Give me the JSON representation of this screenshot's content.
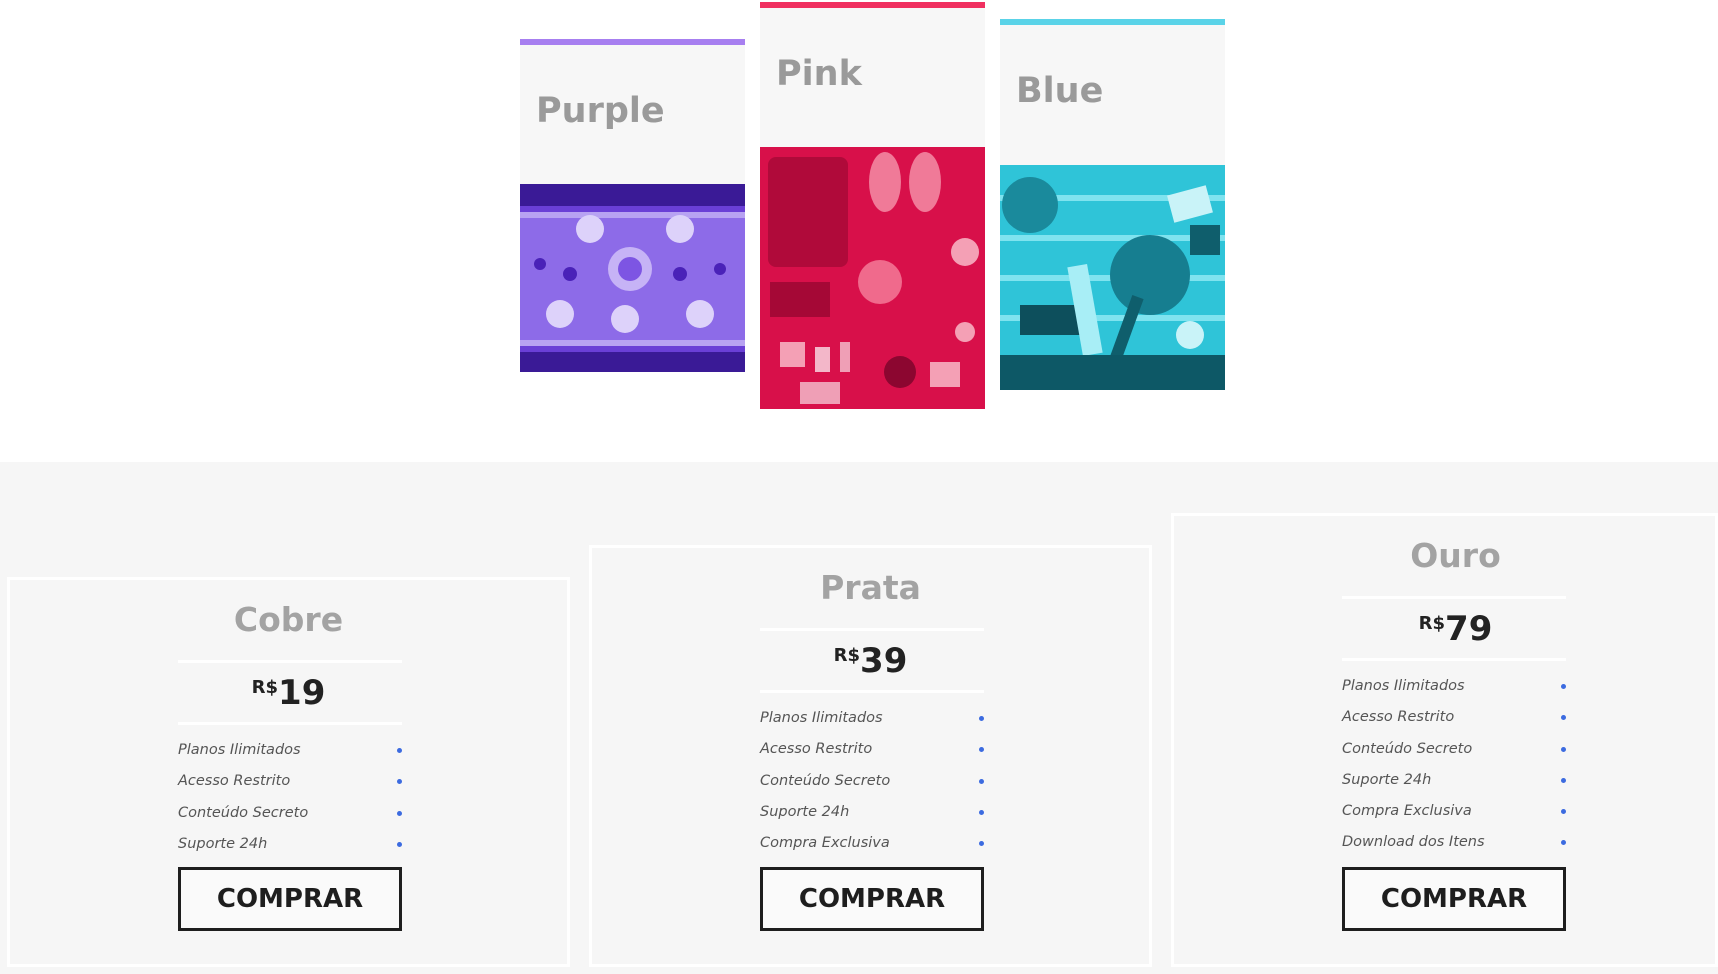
{
  "cards": [
    {
      "title": "Purple",
      "accent": "#a77ff0"
    },
    {
      "title": "Pink",
      "accent": "#f03060"
    },
    {
      "title": "Blue",
      "accent": "#5ad3e8"
    }
  ],
  "plans": [
    {
      "name": "Cobre",
      "currency": "R$",
      "price": "19",
      "features": [
        "Planos Ilimitados",
        "Acesso Restrito",
        "Conteúdo Secreto",
        "Suporte 24h"
      ],
      "button": "COMPRAR"
    },
    {
      "name": "Prata",
      "currency": "R$",
      "price": "39",
      "features": [
        "Planos Ilimitados",
        "Acesso Restrito",
        "Conteúdo Secreto",
        "Suporte 24h",
        "Compra Exclusiva"
      ],
      "button": "COMPRAR"
    },
    {
      "name": "Ouro",
      "currency": "R$",
      "price": "79",
      "features": [
        "Planos Ilimitados",
        "Acesso Restrito",
        "Conteúdo Secreto",
        "Suporte 24h",
        "Compra Exclusiva",
        "Download dos Itens"
      ],
      "button": "COMPRAR"
    }
  ],
  "colors": {
    "feature_dot": "#3c6be0",
    "button_border": "#1e1e1e"
  }
}
